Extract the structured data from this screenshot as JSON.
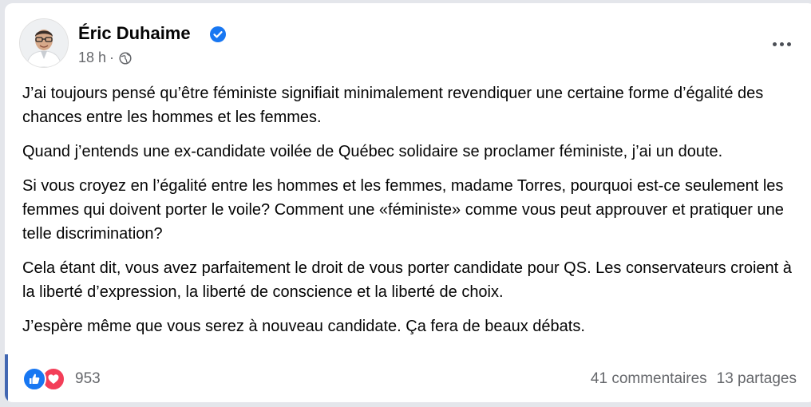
{
  "post": {
    "author": "Éric Duhaime",
    "time": "18 h",
    "separator": "·",
    "paragraphs": [
      "J’ai toujours pensé qu’être féministe signifiait minimalement revendiquer une certaine forme d’égalité des chances entre les hommes et les femmes.",
      "Quand j’entends une ex-candidate voilée de Québec solidaire se proclamer féministe, j’ai un doute.",
      "Si vous croyez en l’égalité entre les hommes et les femmes, madame Torres, pourquoi est-ce seulement les femmes qui doivent porter le voile? Comment une  «féministe» comme vous peut approuver et pratiquer une telle discrimination?",
      "Cela étant dit, vous avez parfaitement le droit de vous porter candidate pour QS. Les conservateurs croient à la liberté d’expression, la liberté de conscience et la liberté de choix.",
      "J’espère même que vous serez à nouveau candidate. Ça fera de beaux débats."
    ],
    "reaction_count": "953",
    "comments": "41 commentaires",
    "shares": "13 partages"
  },
  "icons": {
    "verified": "verified-badge-icon",
    "privacy": "globe-icon",
    "more": "more-options-icon",
    "reactions": [
      "like-icon",
      "love-icon"
    ]
  },
  "colors": {
    "verified": "#1877f2",
    "like": "#1877f2",
    "love": "#f33e58",
    "secondary_text": "#65676b"
  }
}
